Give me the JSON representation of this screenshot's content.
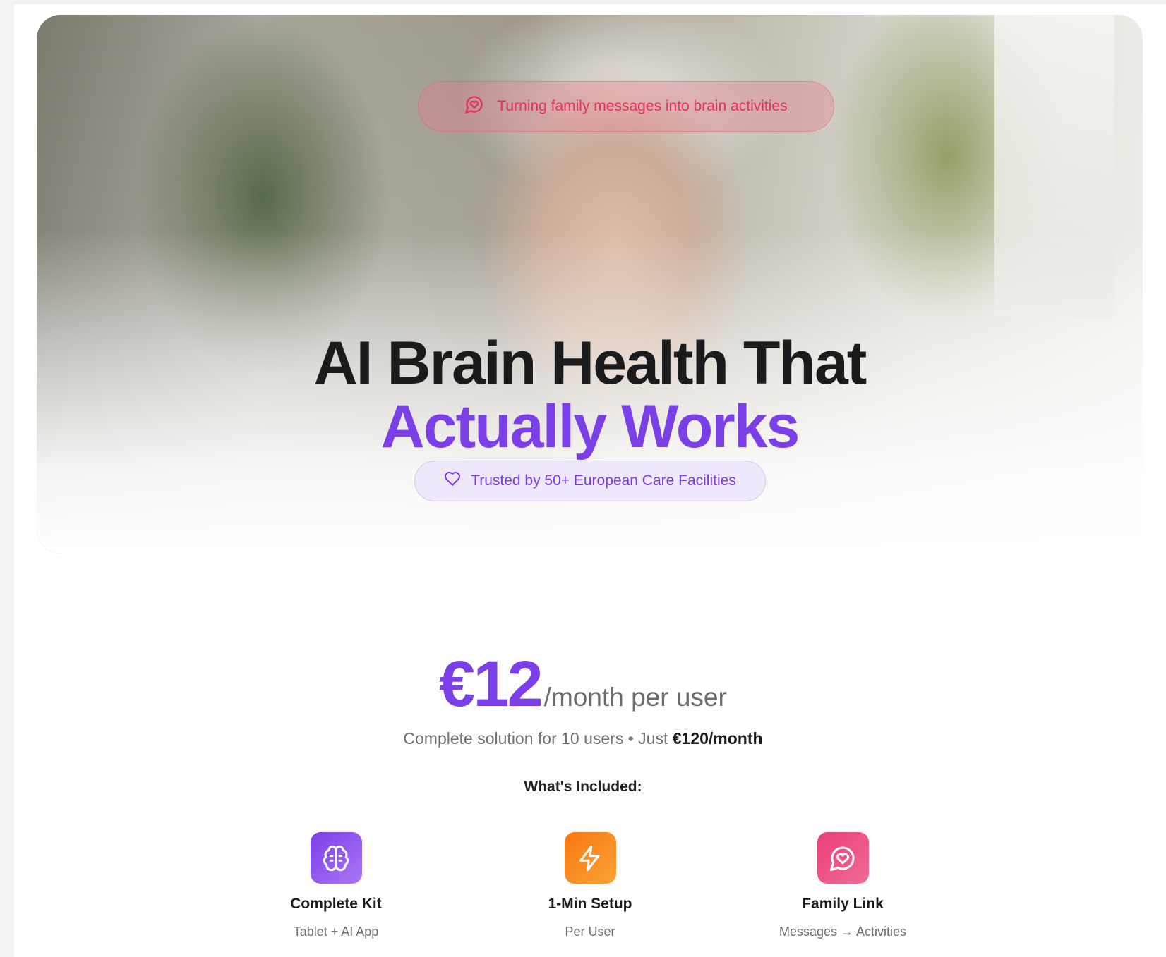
{
  "hero": {
    "tagline": "Turning family messages into brain activities",
    "headline_line1": "AI Brain Health That",
    "headline_line2": "Actually Works",
    "trust_badge": "Trusted by 50+ European Care Facilities"
  },
  "pricing": {
    "price": "€12",
    "unit": "/month per user",
    "subtitle_prefix": "Complete solution for 10 users • Just ",
    "subtitle_bold": "€120/month",
    "included_heading": "What's Included:"
  },
  "features": [
    {
      "icon": "brain-icon",
      "title": "Complete Kit",
      "desc": "Tablet + AI App",
      "color": "#7b3fe8"
    },
    {
      "icon": "lightning-icon",
      "title": "1-Min Setup",
      "desc": "Per User",
      "color": "#f8780f"
    },
    {
      "icon": "message-heart-icon",
      "title": "Family Link",
      "desc": "Messages → Activities",
      "color": "#ec3f79"
    }
  ],
  "colors": {
    "accent": "#7b3fe8",
    "pink": "#e0335e",
    "orange": "#f8780f"
  }
}
